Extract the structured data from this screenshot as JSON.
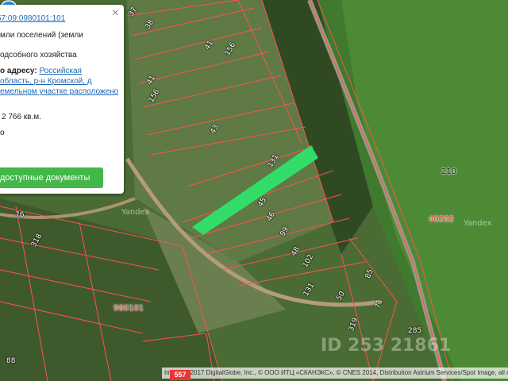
{
  "colors": {
    "parcel_line": "#ff5151",
    "highlight": "#2ee36a",
    "pin": "#2f8ee6",
    "button": "#43b748",
    "link": "#1f69b5"
  },
  "popup": {
    "cadastral_link": "57:09:0980101:101",
    "category": "мли поселений (земли",
    "usage": "одсобного хозяйства",
    "address_label": "о адресу:",
    "address_link_1": "Российская",
    "address_link_2": "область, р-н Кромской, д",
    "address_link_3": "емельном участке расположено",
    "area": "2 766 кв.м.",
    "extra": "о",
    "button_label": "доступные документы",
    "close_icon": "close-icon"
  },
  "map": {
    "parcel_labels": [
      "37",
      "38",
      "41",
      "156",
      "41",
      "156",
      "43",
      "131",
      "45",
      "46",
      "99",
      "48",
      "102",
      "131",
      "50",
      "76",
      "318",
      "88",
      "319",
      "85",
      "71",
      "285",
      "210",
      "40202",
      "980101"
    ],
    "watermark_yandex_1": "Yandex",
    "watermark_yandex_2": "Yandex",
    "watermark_id": "ID 253 21861",
    "badge": "557",
    "attribution": "Image © 2017 DigitalGlobe, Inc., © ООО ИТЦ «СКАНЭКС», © CNES 2014, Distribution Astrium Services/Spot Image, all rights r",
    "marker_icon": "map-pin-icon"
  }
}
